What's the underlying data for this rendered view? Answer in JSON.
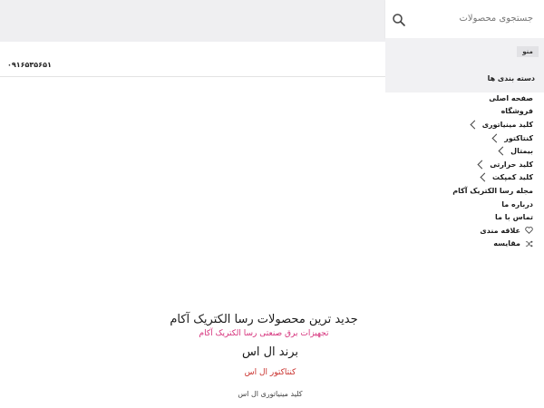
{
  "header": {
    "search_placeholder": "جستجوی محصولات",
    "phone": "۰۹۱۶۵۳۵۶۵۱"
  },
  "sidebar": {
    "tab_label": "منو",
    "categories_label": "دسته بندی ها",
    "items": [
      {
        "label": "صفحه اصلی",
        "icon": null
      },
      {
        "label": "فروشگاه",
        "icon": null
      },
      {
        "label": "کلید مینیاتوری",
        "icon": "chevron-icon"
      },
      {
        "label": "کنتاکتور",
        "icon": "chevron-icon"
      },
      {
        "label": "بیمتال",
        "icon": "chevron-icon"
      },
      {
        "label": "کلید حرارتی",
        "icon": "chevron-icon"
      },
      {
        "label": "کلید کمپکت",
        "icon": "chevron-icon"
      },
      {
        "label": "مجله رسا الکتریک آکام",
        "icon": null
      },
      {
        "label": "درباره ما",
        "icon": null
      },
      {
        "label": "تماس با ما",
        "icon": null
      },
      {
        "label": "علاقه مندی",
        "icon": "heart-icon"
      },
      {
        "label": "مقایسه",
        "icon": "shuffle-icon"
      }
    ]
  },
  "main": {
    "headline": "جدید ترین محصولات رسا الکتریک آکام",
    "subline": "تجهیزات برق صنعتی رسا الکتریک آکام",
    "brand_title": "برند ال اس",
    "brand_link": "کنتاکتور ال اس",
    "brand_item": "کلید مینیاتوری ال اس"
  },
  "colors": {
    "accent": "#d6317b",
    "link_red": "#c9302c",
    "top_band": "#efeff1"
  }
}
